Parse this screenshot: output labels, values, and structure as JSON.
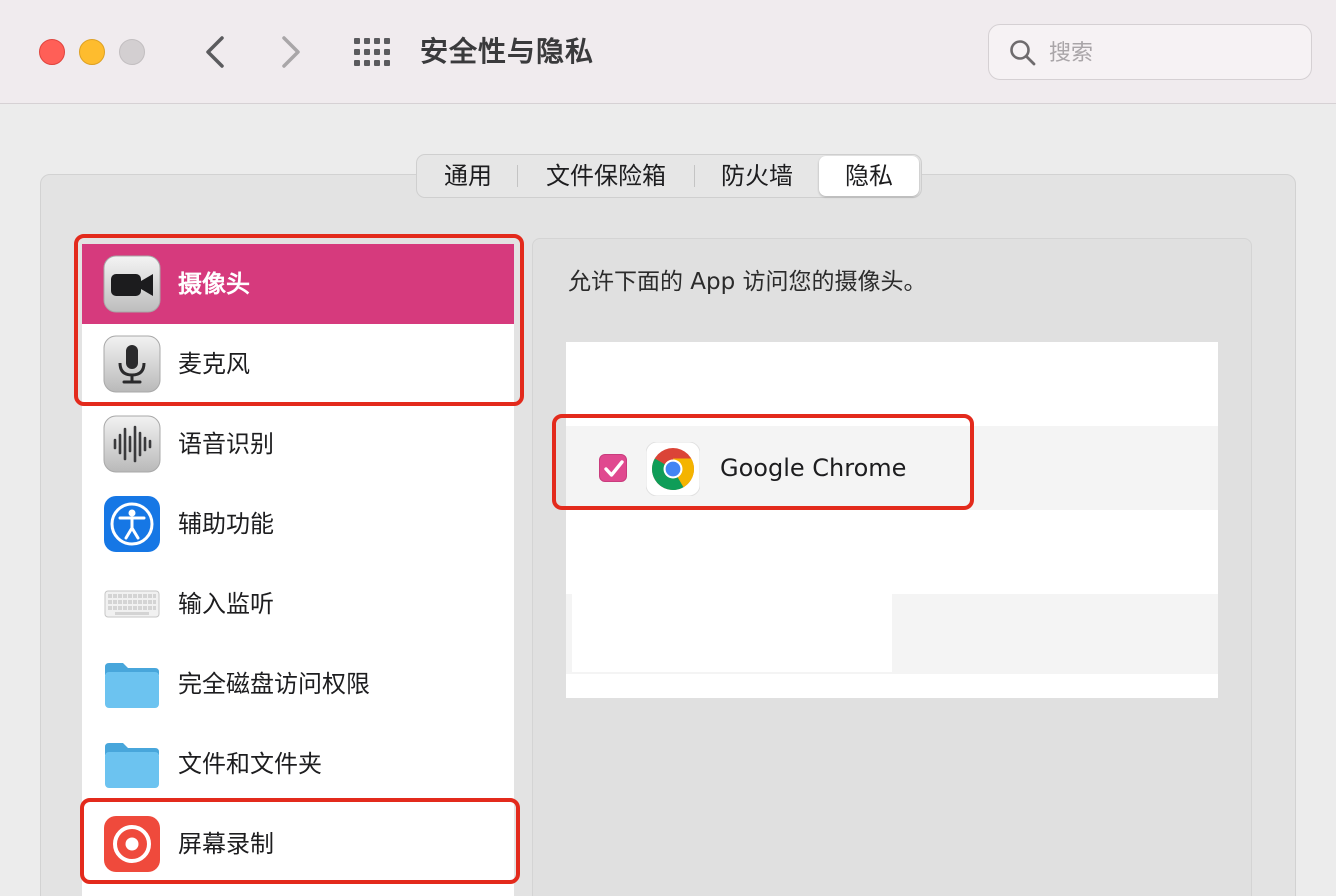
{
  "window": {
    "title": "安全性与隐私"
  },
  "search": {
    "placeholder": "搜索"
  },
  "tabs": [
    {
      "label": "通用",
      "selected": false
    },
    {
      "label": "文件保险箱",
      "selected": false
    },
    {
      "label": "防火墙",
      "selected": false
    },
    {
      "label": "隐私",
      "selected": true
    }
  ],
  "sidebar": {
    "items": [
      {
        "label": "摄像头",
        "icon": "camera-icon",
        "selected": true
      },
      {
        "label": "麦克风",
        "icon": "microphone-icon",
        "selected": false
      },
      {
        "label": "语音识别",
        "icon": "speech-recognition-icon",
        "selected": false
      },
      {
        "label": "辅助功能",
        "icon": "accessibility-icon",
        "selected": false
      },
      {
        "label": "输入监听",
        "icon": "keyboard-icon",
        "selected": false
      },
      {
        "label": "完全磁盘访问权限",
        "icon": "folder-icon",
        "selected": false
      },
      {
        "label": "文件和文件夹",
        "icon": "folder-icon",
        "selected": false
      },
      {
        "label": "屏幕录制",
        "icon": "screen-recording-icon",
        "selected": false
      }
    ]
  },
  "content": {
    "caption": "允许下面的 App 访问您的摄像头。",
    "apps": [
      {
        "name": "Google Chrome",
        "checked": true,
        "icon": "chrome-icon"
      }
    ]
  },
  "colors": {
    "selected_row": "#d63a7d",
    "checkbox": "#e0498f",
    "highlight": "#e32a1c"
  }
}
